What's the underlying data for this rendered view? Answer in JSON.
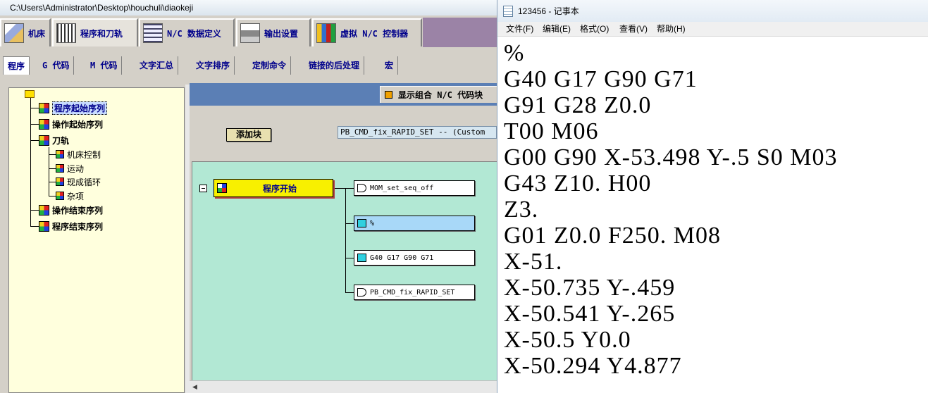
{
  "post_builder": {
    "title": "C:\\Users\\Administrator\\Desktop\\houchuli\\diaokeji",
    "main_tabs": [
      {
        "label": "机床",
        "icon": "machine-tool-icon"
      },
      {
        "label": "程序和刀轨",
        "icon": "program-tool-path-icon"
      },
      {
        "label": "N/C 数据定义",
        "icon": "nc-data-definition-icon"
      },
      {
        "label": "输出设置",
        "icon": "printer-icon"
      },
      {
        "label": "虚拟 N/C 控制器",
        "icon": "virtual-nc-controller-icon"
      }
    ],
    "sub_tabs": [
      "程序",
      "G 代码",
      "M 代码",
      "文字汇总",
      "文字排序",
      "定制命令",
      "链接的后处理",
      "宏"
    ],
    "tree": {
      "items": [
        {
          "label": "程序起始序列",
          "level": 1,
          "selected": true
        },
        {
          "label": "操作起始序列",
          "level": 1
        },
        {
          "label": "刀轨",
          "level": 1
        },
        {
          "label": "机床控制",
          "level": 2
        },
        {
          "label": "运动",
          "level": 2
        },
        {
          "label": "现成循环",
          "level": 2
        },
        {
          "label": "杂项",
          "level": 2
        },
        {
          "label": "操作结束序列",
          "level": 1
        },
        {
          "label": "程序结束序列",
          "level": 1
        }
      ]
    },
    "editor": {
      "combo_button_label": "显示组合 N/C 代码块",
      "add_block_label": "添加块",
      "block_select_value": "PB_CMD_fix_RAPID_SET -- (Custom",
      "event_label": "程序开始",
      "blocks": [
        {
          "label": "MOM_set_seq_off",
          "icon": "hand-icon",
          "selected": false
        },
        {
          "label": "%",
          "icon": "cube-icon",
          "selected": true
        },
        {
          "label": "G40 G17 G90 G71",
          "icon": "cube-icon",
          "selected": false
        },
        {
          "label": "PB_CMD_fix_RAPID_SET",
          "icon": "hand-icon",
          "selected": false
        }
      ]
    }
  },
  "notepad": {
    "title": "123456 - 记事本",
    "menu": [
      "文件(F)",
      "编辑(E)",
      "格式(O)",
      "查看(V)",
      "帮助(H)"
    ],
    "lines": [
      "%",
      "G40 G17 G90 G71",
      "G91 G28 Z0.0",
      "T00 M06",
      "G00 G90 X-53.498 Y-.5 S0 M03",
      "G43 Z10. H00",
      "Z3.",
      "G01 Z0.0 F250. M08",
      "X-51.",
      "X-50.735 Y-.459",
      "X-50.541 Y-.265",
      "X-50.5 Y0.0",
      "X-50.294 Y4.877"
    ]
  }
}
